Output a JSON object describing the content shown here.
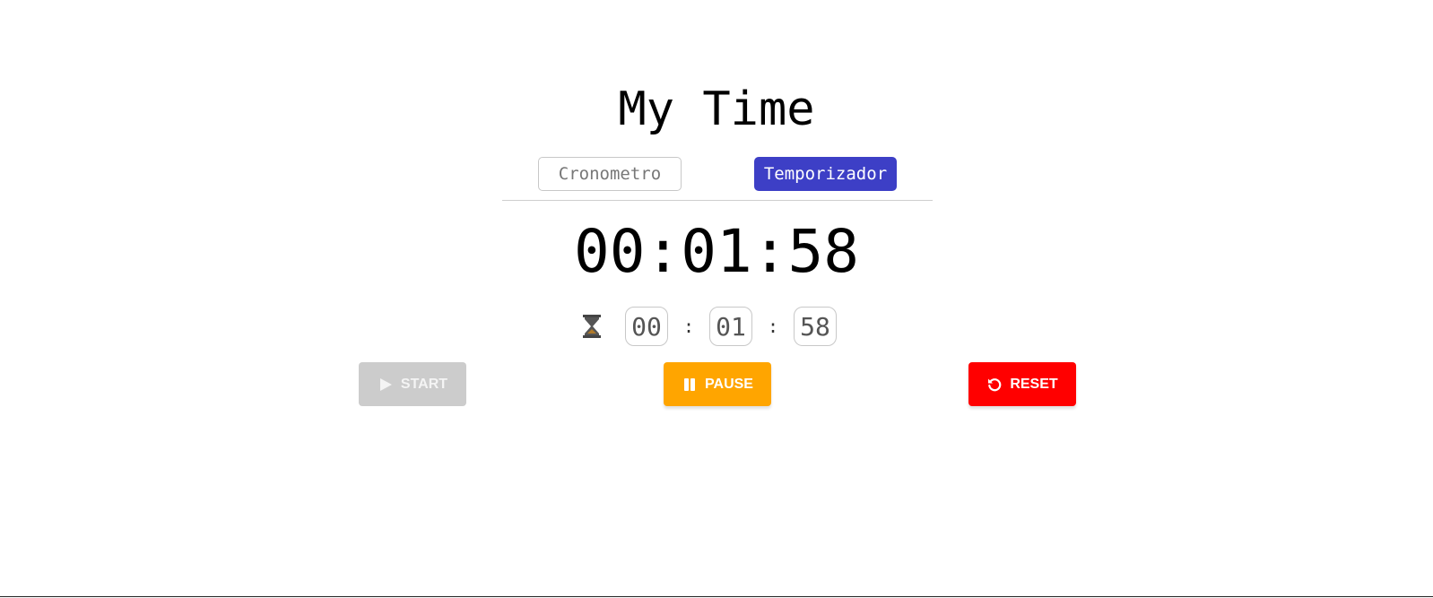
{
  "app": {
    "title": "My Time"
  },
  "tabs": [
    {
      "label": "Cronometro",
      "active": false
    },
    {
      "label": "Temporizador",
      "active": true
    }
  ],
  "clock": {
    "display": "00:01:58"
  },
  "timer_inputs": {
    "icon": "hourglass-icon",
    "hours": "00",
    "minutes": "01",
    "seconds": "58",
    "separator": ":"
  },
  "controls": {
    "start_label": "START",
    "pause_label": "PAUSE",
    "reset_label": "RESET",
    "start_disabled": true
  },
  "colors": {
    "active_tab": "#3d3fc6",
    "start_disabled": "#cccccc",
    "pause": "#ffa500",
    "reset": "#ff0000"
  }
}
